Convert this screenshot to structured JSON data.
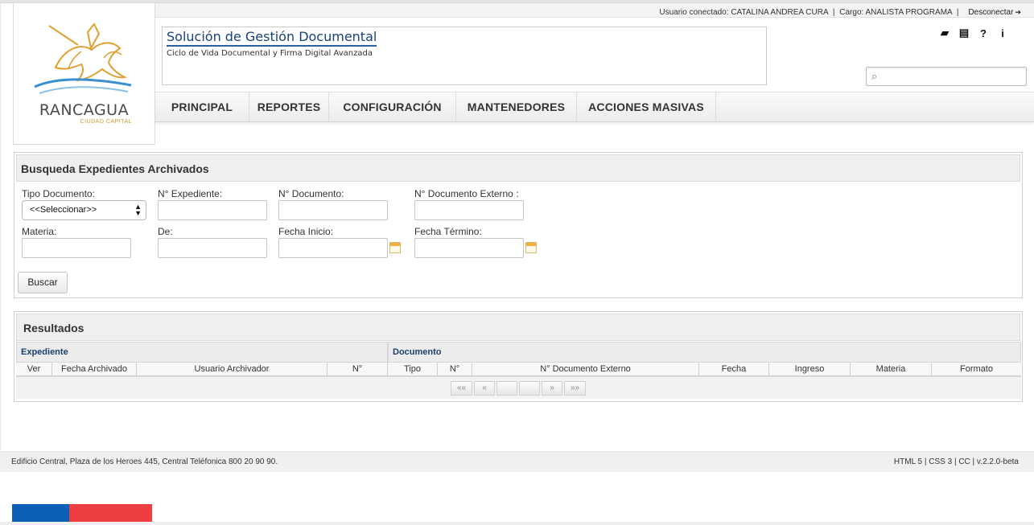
{
  "header": {
    "user_prefix": "Usuario conectado:",
    "user_name": "CATALINA ANDREA CURA",
    "sep1": "|",
    "cargo_prefix": "Cargo:",
    "cargo": "ANALISTA PROGRAMA",
    "sep2": "|",
    "logout_label": "Desconectar",
    "logo_name": "RANCAGUA",
    "logo_subtitle": "CIUDAD CAPITAL",
    "app_title": "Solución de Gestión Documental",
    "app_subtitle": "Ciclo de Vida Documental y Firma Digital Avanzada",
    "icons": [
      {
        "name": "book-icon",
        "glyph": "▰"
      },
      {
        "name": "newspaper-icon",
        "glyph": "▤"
      },
      {
        "name": "help-icon",
        "glyph": "?"
      },
      {
        "name": "info-icon",
        "glyph": "ℹ"
      }
    ],
    "search": {
      "placeholder": "",
      "value": ""
    }
  },
  "nav": {
    "items": [
      "PRINCIPAL",
      "REPORTES",
      "CONFIGURACIÓN",
      "MANTENEDORES",
      "ACCIONES MASIVAS"
    ]
  },
  "search_panel": {
    "title": "Busqueda Expedientes Archivados",
    "fields": {
      "tipo_documento": {
        "label": "Tipo Documento:",
        "value": "<<Seleccionar>>"
      },
      "n_expediente": {
        "label": "N° Expediente:",
        "value": ""
      },
      "n_documento": {
        "label": "N° Documento:",
        "value": ""
      },
      "n_documento_externo": {
        "label": "N° Documento Externo :",
        "value": ""
      },
      "materia": {
        "label": "Materia:",
        "value": ""
      },
      "de": {
        "label": "De:",
        "value": ""
      },
      "fecha_inicio": {
        "label": "Fecha Inicio:",
        "value": ""
      },
      "fecha_termino": {
        "label": "Fecha Término:",
        "value": ""
      }
    },
    "search_button": "Buscar"
  },
  "results": {
    "title": "Resultados",
    "group_expediente": "Expediente",
    "group_documento": "Documento",
    "columns": [
      "Ver",
      "Fecha Archivado",
      "Usuario Archivador",
      "N°",
      "Tipo",
      "N°",
      "N° Documento Externo",
      "Fecha",
      "Ingreso",
      "Materia",
      "Formato"
    ],
    "pager": {
      "first": "««",
      "prev": "«",
      "next": "»",
      "last": "»»"
    }
  },
  "footer": {
    "address": "Edificio Central, Plaza de los Heroes 445, Central Teléfonica 800 20 90 90.",
    "tech": "HTML 5 | CSS 3 | CC | v.2.2.0-beta"
  },
  "colors": {
    "title_blue": "#17427a",
    "group_blue": "#1d3f6e",
    "flag_blue": "#0b5fb4",
    "flag_red": "#ef3e42"
  }
}
